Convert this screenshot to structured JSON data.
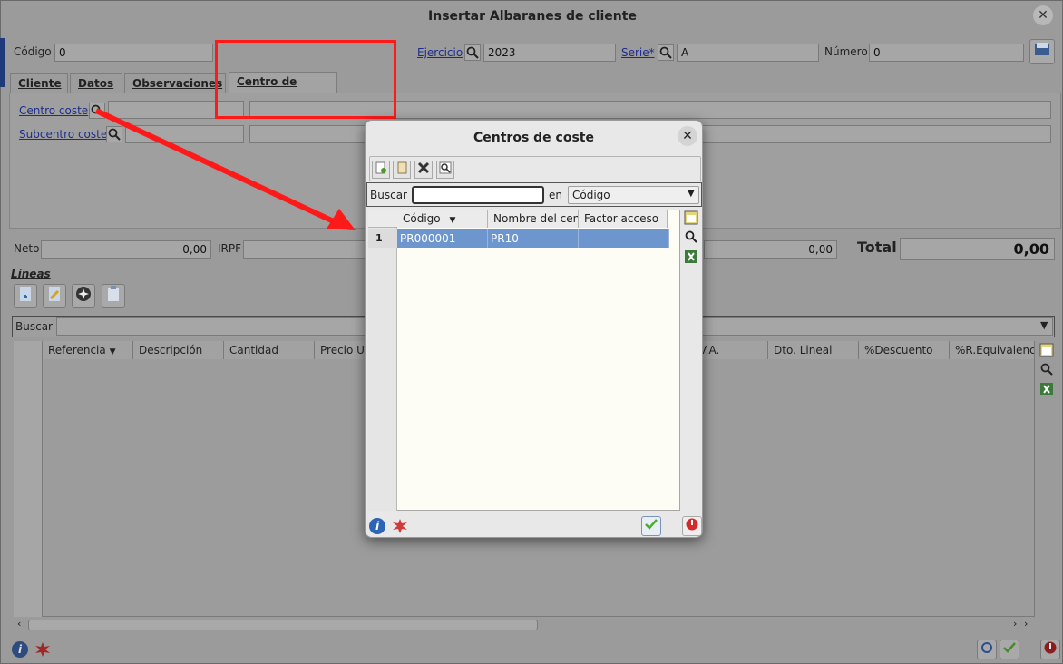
{
  "window": {
    "title": "Insertar Albaranes de cliente"
  },
  "header": {
    "codigo_label": "Código",
    "codigo_value": "0",
    "ejercicio_label": "Ejercicio",
    "ejercicio_value": "2023",
    "serie_label": "Serie*",
    "serie_value": "A",
    "numero_label": "Número",
    "numero_value": "0"
  },
  "tabs": [
    {
      "label": "Cliente"
    },
    {
      "label": "Datos"
    },
    {
      "label": "Observaciones"
    },
    {
      "label": "Centro de coste"
    }
  ],
  "centro_tab": {
    "centro_label": "Centro coste",
    "subcentro_label": "Subcentro coste"
  },
  "totals": {
    "neto_label": "Neto",
    "neto_value": "0,00",
    "irpf_label": "IRPF",
    "mid_value": "0,00",
    "total_label": "Total",
    "total_value": "0,00"
  },
  "lineas": {
    "title": "Líneas",
    "search_label": "Buscar",
    "columns": [
      "Referencia",
      "Descripción",
      "Cantidad",
      "Precio Ur",
      "",
      "V.A.",
      "Dto. Lineal",
      "%Descuento",
      "%R.Equivalenci"
    ]
  },
  "dialog": {
    "title": "Centros de coste",
    "search_label": "Buscar",
    "search_value": "",
    "in_label": "en",
    "field_select": "Código",
    "columns": [
      "Código",
      "Nombre del cen",
      "Factor acceso"
    ],
    "rows": [
      {
        "num": "1",
        "codigo": "PR000001",
        "nombre": "PR10",
        "factor": ""
      }
    ]
  },
  "colors": {
    "selection": "#6d96cf",
    "link": "#1d2d8c",
    "annotation": "#ff0000",
    "grid_bg": "#fdfdf5"
  }
}
